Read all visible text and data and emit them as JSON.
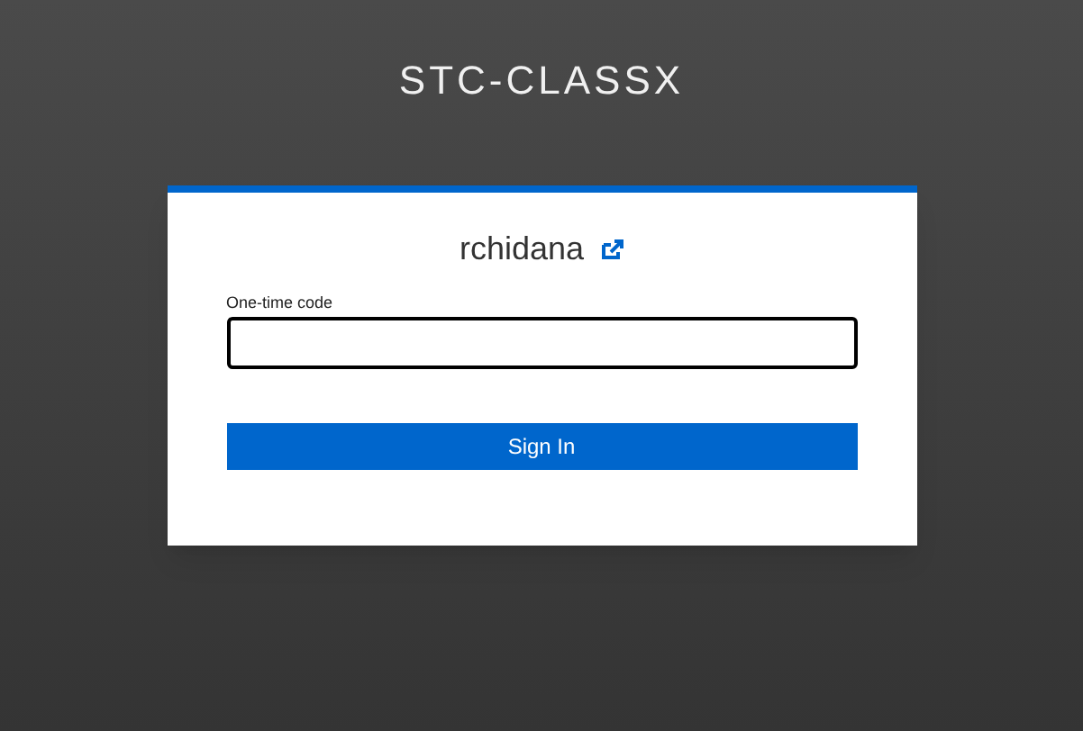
{
  "header": {
    "title": "STC-CLASSX"
  },
  "login": {
    "username": "rchidana",
    "field": {
      "label": "One-time code"
    },
    "button": "Sign In"
  }
}
